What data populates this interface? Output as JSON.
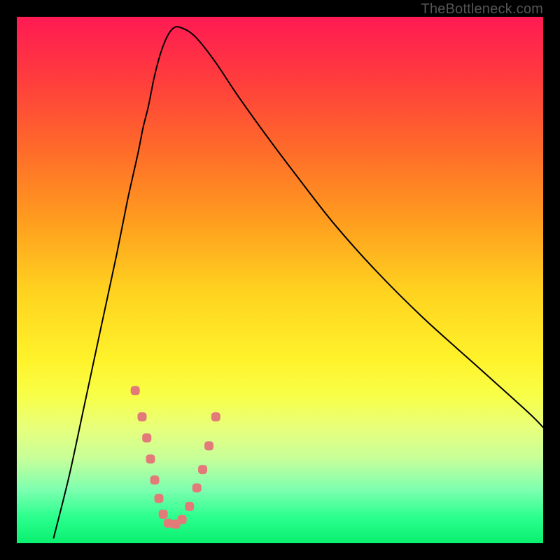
{
  "watermark": "TheBottleneck.com",
  "chart_data": {
    "type": "line",
    "title": "",
    "xlabel": "",
    "ylabel": "",
    "xlim": [
      0,
      100
    ],
    "ylim": [
      0,
      100
    ],
    "grid": false,
    "legend": false,
    "series": [
      {
        "name": "bottleneck-curve",
        "x": [
          7,
          10,
          13,
          16,
          19,
          21,
          23,
          24,
          25,
          26,
          27,
          28,
          29,
          30,
          31,
          33,
          35,
          38,
          42,
          47,
          53,
          60,
          68,
          77,
          87,
          97,
          100
        ],
        "y": [
          1,
          13,
          27,
          41,
          55,
          65,
          74,
          79,
          83,
          88,
          92,
          95,
          97,
          98,
          98,
          97,
          95,
          91,
          85,
          78,
          70,
          61,
          52,
          43,
          34,
          25,
          22
        ]
      }
    ],
    "markers": {
      "name": "salmon-dots",
      "x": [
        22.5,
        23.8,
        24.7,
        25.4,
        26.2,
        27.0,
        27.8,
        28.8,
        30.2,
        31.4,
        32.8,
        34.2,
        35.3,
        36.5,
        37.8
      ],
      "y": [
        29.0,
        24.0,
        20.0,
        16.0,
        12.0,
        8.5,
        5.5,
        3.8,
        3.6,
        4.5,
        7.0,
        10.5,
        14.0,
        18.5,
        24.0
      ]
    },
    "background_gradient": {
      "type": "vertical",
      "stops": [
        {
          "pos": 0.0,
          "color": "#ff1a53"
        },
        {
          "pos": 0.25,
          "color": "#ff6a2a"
        },
        {
          "pos": 0.55,
          "color": "#fff22a"
        },
        {
          "pos": 0.8,
          "color": "#c6ff9a"
        },
        {
          "pos": 1.0,
          "color": "#09f06f"
        }
      ]
    }
  }
}
